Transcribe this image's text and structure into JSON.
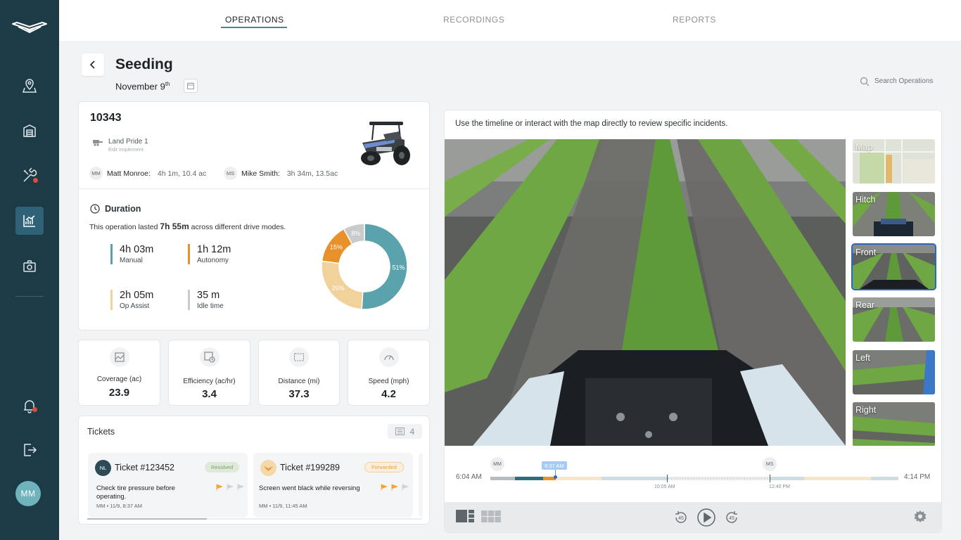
{
  "nav": {
    "tabs": [
      {
        "label": "OPERATIONS",
        "active": true
      },
      {
        "label": "RECORDINGS",
        "active": false
      },
      {
        "label": "REPORTS",
        "active": false
      }
    ]
  },
  "sidebar": {
    "items": [
      "map-pin-icon",
      "garage-icon",
      "tools-icon",
      "analytics-icon",
      "camera-icon"
    ],
    "active_item": "analytics-icon",
    "bottom": [
      "bell-icon",
      "logout-icon"
    ],
    "user_initials": "MM"
  },
  "header": {
    "title": "Seeding",
    "date": "November 9",
    "date_suffix": "th",
    "search_placeholder": "Search Operations"
  },
  "operation": {
    "id": "10343",
    "implement": "Land Pride 1",
    "implement_action": "Edit Implement",
    "operators": [
      {
        "initials": "MM",
        "name": "Matt Monroe:",
        "stats": "4h 1m, 10.4 ac"
      },
      {
        "initials": "MS",
        "name": "Mike Smith:",
        "stats": "3h 34m, 13.5ac"
      }
    ]
  },
  "duration": {
    "heading": "Duration",
    "desc_prefix": "This operation lasted ",
    "desc_total": "7h 55m",
    "desc_suffix": " across different drive modes.",
    "modes": [
      {
        "value": "4h 03m",
        "label": "Manual",
        "color": "#5aa3ad"
      },
      {
        "value": "1h 12m",
        "label": "Autonomy",
        "color": "#e8912a"
      },
      {
        "value": "2h 05m",
        "label": "Op Assist",
        "color": "#f0d29a"
      },
      {
        "value": "35 m",
        "label": "Idle time",
        "color": "#c8cacc"
      }
    ],
    "donut": [
      {
        "label": "51%",
        "percent": 51,
        "color": "#5aa3ad"
      },
      {
        "label": "26%",
        "percent": 26,
        "color": "#f0d29a"
      },
      {
        "label": "15%",
        "percent": 15,
        "color": "#e8912a"
      },
      {
        "label": "8%",
        "percent": 8,
        "color": "#c8cacc"
      }
    ]
  },
  "metrics": [
    {
      "label": "Coverage (ac)",
      "value": "23.9",
      "icon": "coverage-icon"
    },
    {
      "label": "Efficiency (ac/hr)",
      "value": "3.4",
      "icon": "efficiency-icon"
    },
    {
      "label": "Distance (mi)",
      "value": "37.3",
      "icon": "distance-icon"
    },
    {
      "label": "Speed (mph)",
      "value": "4.2",
      "icon": "speedometer-icon"
    }
  ],
  "tickets": {
    "title": "Tickets",
    "count": "4",
    "items": [
      {
        "avatar": "NL",
        "avatar_color": "#2d4b57",
        "title": "Ticket #123452",
        "status": "Resolved",
        "status_color": "#7aa36b",
        "status_bg": "#dfe9d9",
        "description": "Check tire pressure before operating.",
        "meta": "MM • 11/9, 8:37 AM",
        "priority": 1
      },
      {
        "avatar": "",
        "avatar_color": "#f4d8a8",
        "title": "Ticket #199289",
        "status": "Forwarded",
        "status_color": "#e8a24a",
        "status_bg": "#fbeedc",
        "description": "Screen went black while reversing",
        "meta": "MM • 11/9, 11:45 AM",
        "priority": 2
      }
    ]
  },
  "video": {
    "hint": "Use the timeline or interact with the map directly to review specific incidents.",
    "views": [
      "Map",
      "Hitch",
      "Front",
      "Rear",
      "Left",
      "Right"
    ],
    "selected_view": "Front"
  },
  "timeline": {
    "start": "6:04 AM",
    "end": "4:14 PM",
    "current": "8:37 AM",
    "ticks": [
      "10:05 AM",
      "12:40 PM"
    ],
    "operators": [
      "MM",
      "MS"
    ]
  },
  "controls": {
    "rewind_label": "45",
    "forward_label": "45"
  }
}
